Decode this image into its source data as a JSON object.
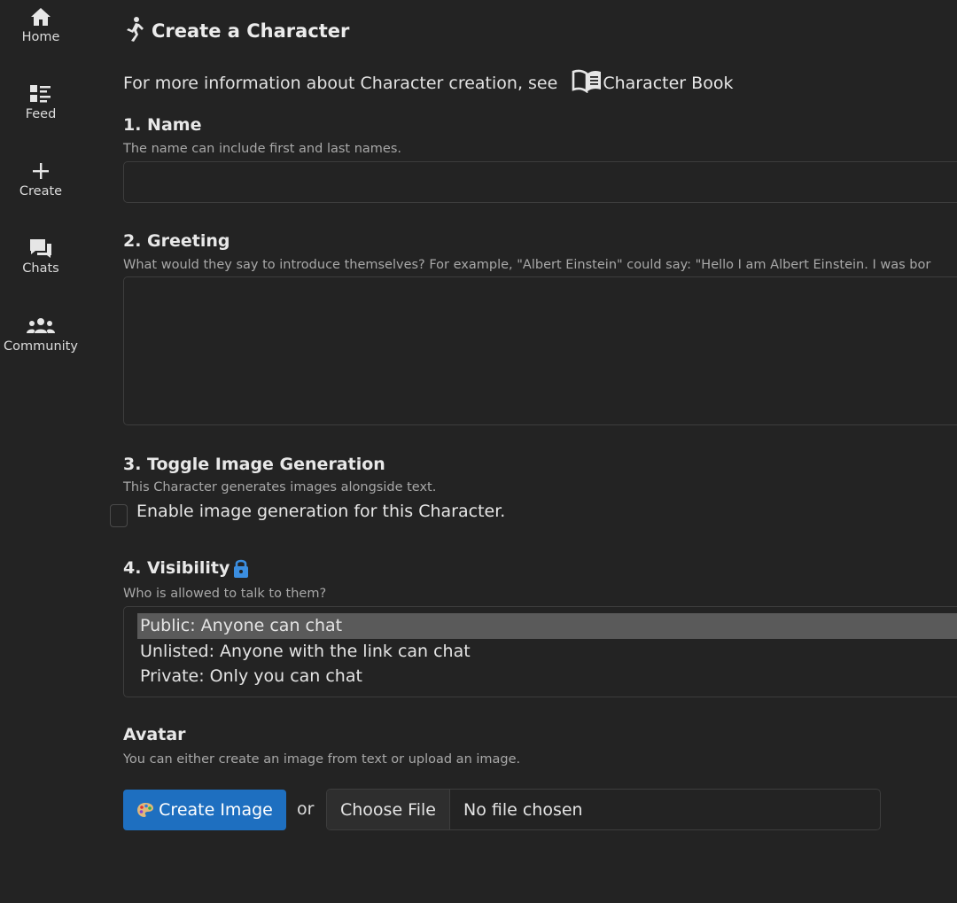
{
  "nav": {
    "items": [
      {
        "label": "Home",
        "icon": "home-icon"
      },
      {
        "label": "Feed",
        "icon": "feed-icon"
      },
      {
        "label": "Create",
        "icon": "plus-icon"
      },
      {
        "label": "Chats",
        "icon": "chats-icon"
      },
      {
        "label": "Community",
        "icon": "community-icon"
      }
    ]
  },
  "page": {
    "title": "Create a Character",
    "info_text": "For more information about Character creation, see",
    "book_link": "Character Book"
  },
  "name": {
    "title": "1. Name",
    "help": "The name can include first and last names.",
    "value": ""
  },
  "greeting": {
    "title": "2. Greeting",
    "help": "What would they say to introduce themselves? For example, \"Albert Einstein\" could say: \"Hello I am Albert Einstein. I was bor",
    "value": ""
  },
  "image_gen": {
    "title": "3. Toggle Image Generation",
    "help": "This Character generates images alongside text.",
    "checkbox_label": "Enable image generation for this Character.",
    "checked": false
  },
  "visibility": {
    "title": "4. Visibility",
    "help": "Who is allowed to talk to them?",
    "options": [
      "Public: Anyone can chat",
      "Unlisted: Anyone with the link can chat",
      "Private: Only you can chat"
    ],
    "selected_index": 0
  },
  "avatar": {
    "title": "Avatar",
    "help": "You can either create an image from text or upload an image.",
    "create_button": "Create Image",
    "or_text": "or",
    "choose_file": "Choose File",
    "no_file": "No file chosen"
  },
  "colors": {
    "background": "#232323",
    "accent_button": "#1e6fc0",
    "lock_icon": "#3b8ee0",
    "selected_option": "#5a5a5a"
  }
}
